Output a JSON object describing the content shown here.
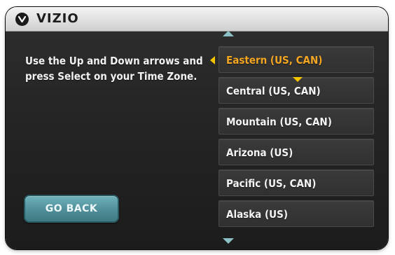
{
  "brand": {
    "name": "VIZIO",
    "logo_icon": "vizio-logo-icon"
  },
  "instructions": "Use the Up and Down arrows and press Select on your Time Zone.",
  "actions": {
    "go_back_label": "GO BACK"
  },
  "timezone_list": {
    "scroll_up_icon": "arrow-up-icon",
    "scroll_down_icon": "arrow-down-icon",
    "selected_index": 0,
    "items": [
      {
        "label": "Eastern (US, CAN)"
      },
      {
        "label": "Central (US, CAN)"
      },
      {
        "label": "Mountain (US, CAN)"
      },
      {
        "label": "Arizona (US)"
      },
      {
        "label": "Pacific (US, CAN)"
      },
      {
        "label": "Alaska (US)"
      }
    ]
  },
  "colors": {
    "selected_text": "#f5a623",
    "pointer": "#f5c400",
    "accent_teal": "#4f8f99",
    "panel_bg": "#262626"
  }
}
